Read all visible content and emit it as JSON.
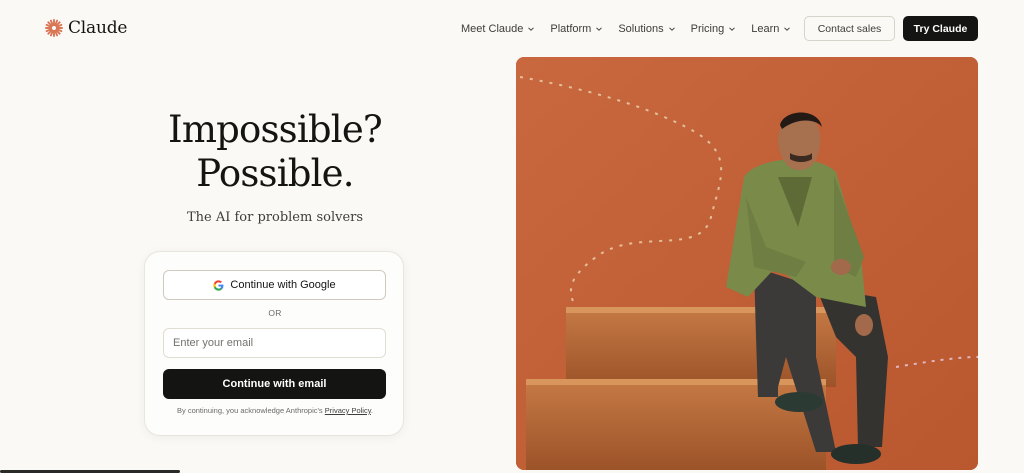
{
  "brand": {
    "name": "Claude",
    "color": "#d97757"
  },
  "nav": {
    "items": [
      {
        "label": "Meet Claude"
      },
      {
        "label": "Platform"
      },
      {
        "label": "Solutions"
      },
      {
        "label": "Pricing"
      },
      {
        "label": "Learn"
      }
    ],
    "contact_label": "Contact sales",
    "try_label": "Try Claude"
  },
  "hero": {
    "title_line1": "Impossible?",
    "title_line2": "Possible.",
    "subtitle": "The AI for problem solvers"
  },
  "login": {
    "google_label": "Continue with Google",
    "or_label": "OR",
    "email_placeholder": "Enter your email",
    "email_value": "",
    "email_button_label": "Continue with email",
    "legal_prefix": "By continuing, you acknowledge Anthropic's",
    "legal_link": "Privacy Policy",
    "legal_suffix": "."
  },
  "colors": {
    "background": "#faf9f5",
    "primary_button": "#141413",
    "image_background": "#c4623a"
  },
  "icons": {
    "logo": "asterisk-starburst-icon",
    "google": "google-g-icon",
    "chevron": "chevron-down-icon"
  }
}
